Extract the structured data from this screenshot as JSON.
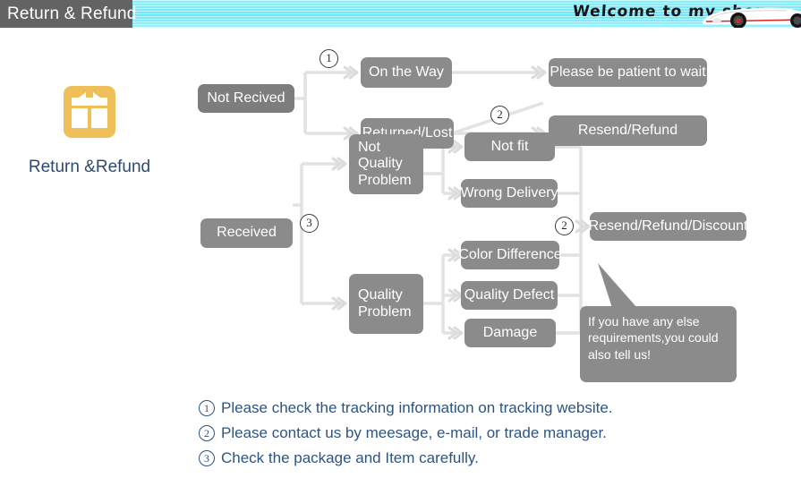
{
  "banner": {
    "title": "Return & Refund",
    "welcome": "Welcome to my shop",
    "car_icon": "sports-car-icon",
    "stripe_color": "#6fe4f6",
    "title_bg": "#636363"
  },
  "brand": {
    "icon": "gift-box-icon",
    "icon_color": "#efc05a",
    "label": "Return &Refund",
    "label_color": "#2d4a72"
  },
  "flow": {
    "node_color": "#8b8b8b",
    "node_color_dark": "#7d7d7d",
    "connector_color": "#e2e2e2",
    "nodes": {
      "not_received": "Not Recived",
      "on_the_way": "On the Way",
      "returned_lost": "Returned/Lost",
      "please_wait": "Please be patient to wait",
      "resend_refund": "Resend/Refund",
      "received": "Received",
      "not_quality_problem": "Not Quality Problem",
      "quality_problem": "Quality Problem",
      "not_fit": "Not fit",
      "wrong_delivery": "Wrong Delivery",
      "color_difference": "Color Difference",
      "quality_defect": "Quality Defect",
      "damage": "Damage",
      "resend_refund_discount": "Resend/Refund/Discount"
    },
    "markers": {
      "m1": "1",
      "m2_top": "2",
      "m3": "3",
      "m2_mid": "2"
    }
  },
  "callout": {
    "text": "If you have any else requirements,you could also tell us!"
  },
  "notes": {
    "text_color": "#2d5482",
    "items": [
      {
        "num": "1",
        "text": "Please check the tracking information on tracking website."
      },
      {
        "num": "2",
        "text": "Please contact us by meesage, e-mail, or trade manager."
      },
      {
        "num": "3",
        "text": "Check the package and Item carefully."
      }
    ]
  }
}
